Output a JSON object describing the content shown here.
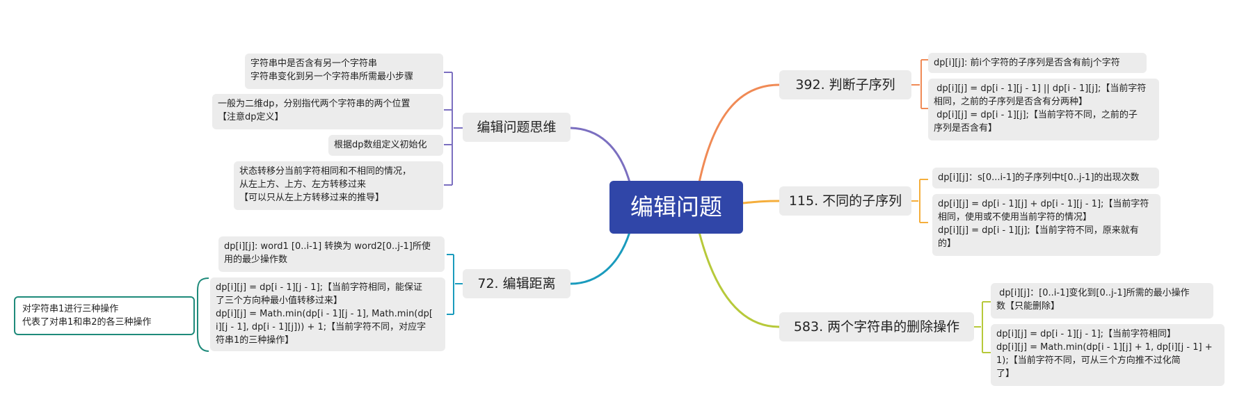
{
  "root": {
    "title": "编辑问题"
  },
  "left": {
    "thinking": {
      "title": "编辑问题思维",
      "notes": [
        "字符串中是否含有另一个字符串\n字符串变化到另一个字符串所需最小步骤",
        "一般为二维dp，分别指代两个字符串的两个位置\n【注意dp定义】",
        "根据dp数组定义初始化",
        "状态转移分当前字符相同和不相同的情况，\n从左上方、上方、左方转移过来\n【可以只从左上方转移过来的推导】"
      ]
    },
    "edit_distance": {
      "title": "72. 编辑距离",
      "notes": [
        "dp[i][j]: word1 [0..i-1] 转换为 word2[0..j-1]所使\n用的最少操作数",
        "dp[i][j] = dp[i - 1][j - 1];【当前字符相同，能保证\n了三个方向种最小值转移过来】\ndp[i][j] = Math.min(dp[i - 1][j - 1], Math.min(dp[\ni][j - 1], dp[i - 1][j])) + 1;【当前字符不同，对应字\n符串1的三种操作】"
      ],
      "summary": "对字符串1进行三种操作\n代表了对串1和串2的各三种操作"
    }
  },
  "right": {
    "subsequence": {
      "title": "392. 判断子序列",
      "notes": [
        "dp[i][j]: 前i个字符的子序列是否含有前j个字符",
        " dp[i][j] = dp[i - 1][j - 1] || dp[i - 1][j];【当前字符\n相同，之前的子序列是否含有分两种】\n dp[i][j] = dp[i - 1][j];【当前字符不同，之前的子\n序列是否含有】"
      ]
    },
    "distinct": {
      "title": "115. 不同的子序列",
      "notes": [
        "dp[i][j]：s[0...i-1]的子序列中t[0..j-1]的出现次数",
        "dp[i][j] = dp[i - 1][j] + dp[i - 1][j - 1];【当前字符\n相同，使用或不使用当前字符的情况】\ndp[i][j] = dp[i - 1][j];【当前字符不同，原来就有\n的】"
      ]
    },
    "delete": {
      "title": "583. 两个字符串的删除操作",
      "notes": [
        " dp[i][j]：[0..i-1]变化到[0..j-1]所需的最小操作\n数【只能删除】",
        "dp[i][j] = dp[i - 1][j - 1];【当前字符相同】\ndp[i][j] = Math.min(dp[i - 1][j] + 1, dp[i][j - 1] +\n1);【当前字符不同，可从三个方向推不过化简\n了】"
      ]
    }
  },
  "colors": {
    "root_bg": "#3046a8",
    "thinking": "#7b6fc0",
    "edit_distance": "#1a9bbd",
    "subsequence": "#f08a55",
    "distinct": "#f5ae3c",
    "delete": "#b7c93a",
    "summary_border": "#1e8a7a"
  }
}
